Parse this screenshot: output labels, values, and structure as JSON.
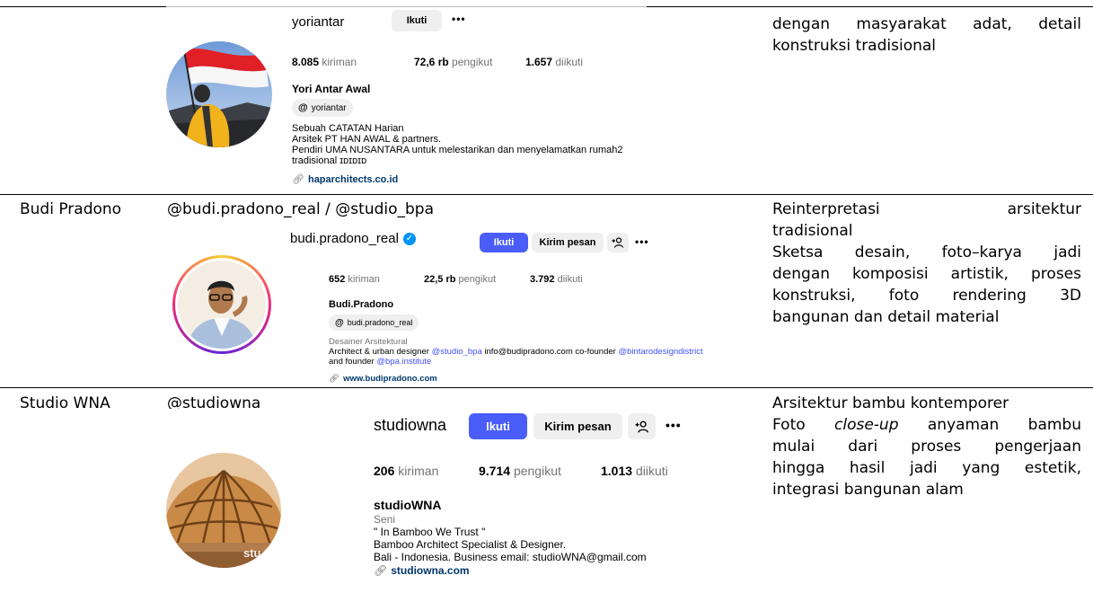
{
  "rows": [
    {
      "name": "",
      "handle": "",
      "description": [
        "dengan masyarakat adat, detail",
        "konstruksi tradisional"
      ],
      "profile": {
        "username": "yoriantar",
        "follow_label": "Ikuti",
        "more": "•••",
        "posts_count": "8.085",
        "posts_label": "kiriman",
        "followers_count": "72,6 rb",
        "followers_label": "pengikut",
        "following_count": "1.657",
        "following_label": "diikuti",
        "full_name": "Yori Antar Awal",
        "threads_handle": "yoriantar",
        "bio": [
          "Sebuah CATATAN Harian",
          "Arsitek PT HAN AWAL & partners.",
          "Pendiri UMA NUSANTARA untuk melestarikan dan menyelamatkan rumah2",
          "tradisional ɪᴅɪᴅɪᴅ"
        ],
        "link": "haparchitects.co.id"
      }
    },
    {
      "name": "Budi Pradono",
      "handle": "@budi.pradono_real / @studio_bpa",
      "description": [
        "Reinterpretasi arsitektur",
        "tradisional",
        "Sketsa desain, foto–karya jadi",
        "dengan komposisi artistik, proses",
        "konstruksi, foto rendering 3D",
        "bangunan dan detail material"
      ],
      "profile": {
        "username": "budi.pradono_real",
        "follow_label": "Ikuti",
        "message_label": "Kirim pesan",
        "more": "•••",
        "posts_count": "652",
        "posts_label": "kiriman",
        "followers_count": "22,5 rb",
        "followers_label": "pengikut",
        "following_count": "3.792",
        "following_label": "diikuti",
        "full_name": "Budi.Pradono",
        "threads_handle": "budi.pradono_real",
        "category": "Desainer Arsitektural",
        "bio_line1_a": "Architect & urban designer ",
        "bio_line1_link1": "@studio_bpa",
        "bio_line1_b": " info@budipradono.com co-founder ",
        "bio_line1_link2": "@bintarodesigndistrict",
        "bio_line2_a": "and founder ",
        "bio_line2_link": "@bpa.institute",
        "link": "www.budipradono.com"
      }
    },
    {
      "name": "Studio WNA",
      "handle": "@studiowna",
      "description_line1": "Arsitektur bambu kontemporer",
      "description_line2_a": "Foto ",
      "description_line2_em": "close-up",
      "description_line2_b": " anyaman bambu",
      "description_rest": [
        "mulai dari proses pengerjaan",
        "hingga hasil jadi yang estetik,",
        "integrasi bangunan alam"
      ],
      "profile": {
        "username": "studiowna",
        "follow_label": "Ikuti",
        "message_label": "Kirim pesan",
        "more": "•••",
        "posts_count": "206",
        "posts_label": "kiriman",
        "followers_count": "9.714",
        "followers_label": "pengikut",
        "following_count": "1.013",
        "following_label": "diikuti",
        "full_name": "studioWNA",
        "category": "Seni",
        "bio": [
          "\" In Bamboo We Trust \"",
          "Bamboo Architect Specialist & Designer.",
          "Bali - Indonesia. Business email: studioWNA@gmail.com"
        ],
        "link": "studiowna.com",
        "watermark": "stu"
      }
    }
  ]
}
